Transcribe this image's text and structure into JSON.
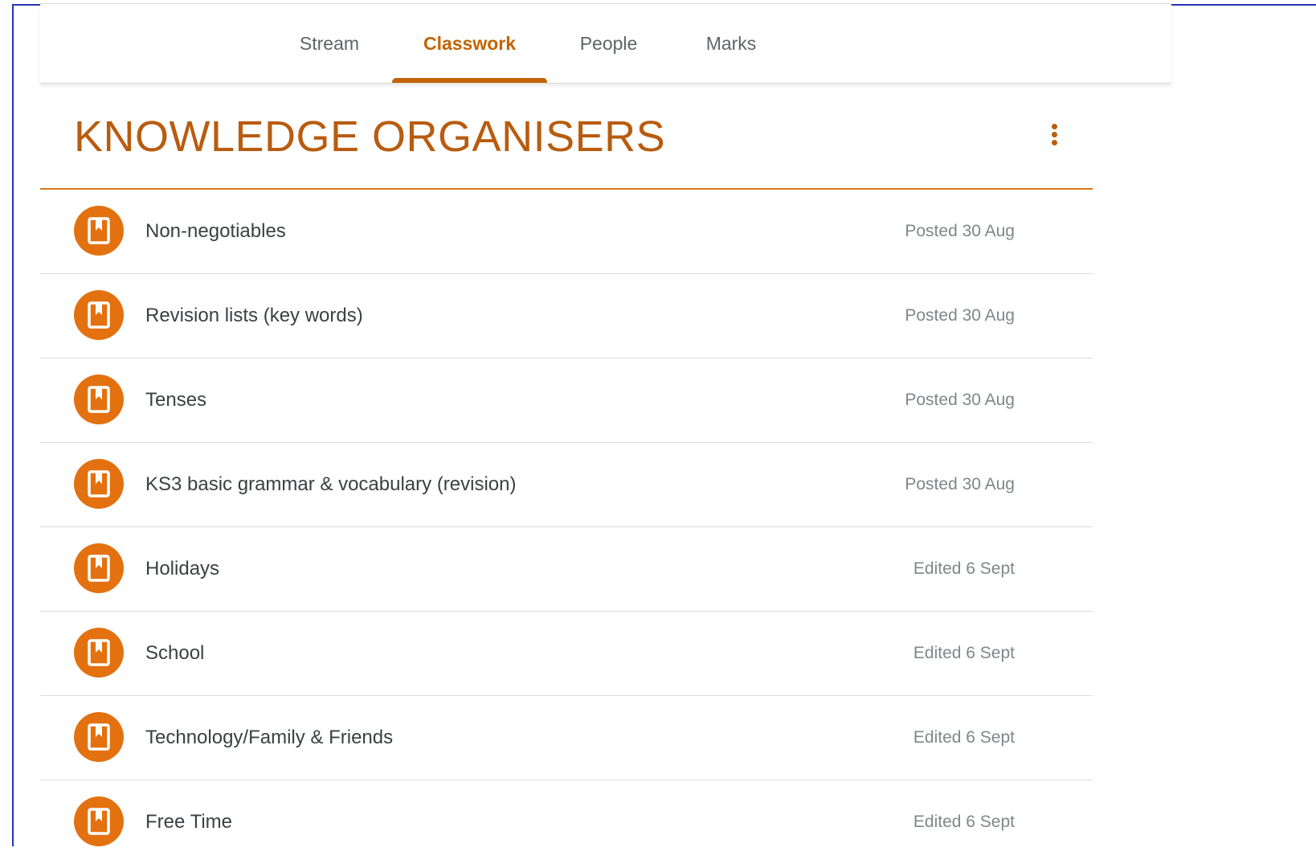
{
  "tabs": [
    {
      "label": "Stream",
      "active": false
    },
    {
      "label": "Classwork",
      "active": true
    },
    {
      "label": "People",
      "active": false
    },
    {
      "label": "Marks",
      "active": false
    }
  ],
  "topic": {
    "title": "KNOWLEDGE ORGANISERS",
    "more_icon": "more-vert-icon"
  },
  "items": [
    {
      "title": "Non-negotiables",
      "meta": "Posted 30 Aug",
      "icon": "material-bookmark-icon"
    },
    {
      "title": "Revision lists (key words)",
      "meta": "Posted 30 Aug",
      "icon": "material-bookmark-icon"
    },
    {
      "title": "Tenses",
      "meta": "Posted 30 Aug",
      "icon": "material-bookmark-icon"
    },
    {
      "title": "KS3 basic grammar & vocabulary (revision)",
      "meta": "Posted 30 Aug",
      "icon": "material-bookmark-icon"
    },
    {
      "title": "Holidays",
      "meta": "Edited 6 Sept",
      "icon": "material-bookmark-icon"
    },
    {
      "title": "School",
      "meta": "Edited 6 Sept",
      "icon": "material-bookmark-icon"
    },
    {
      "title": "Technology/Family & Friends",
      "meta": "Edited 6 Sept",
      "icon": "material-bookmark-icon"
    },
    {
      "title": "Free Time",
      "meta": "Edited 6 Sept",
      "icon": "material-bookmark-icon"
    }
  ],
  "colors": {
    "accent": "#c26401",
    "icon_bg": "#e3710f",
    "title": "#b85c0f",
    "frame": "#2435b8"
  }
}
